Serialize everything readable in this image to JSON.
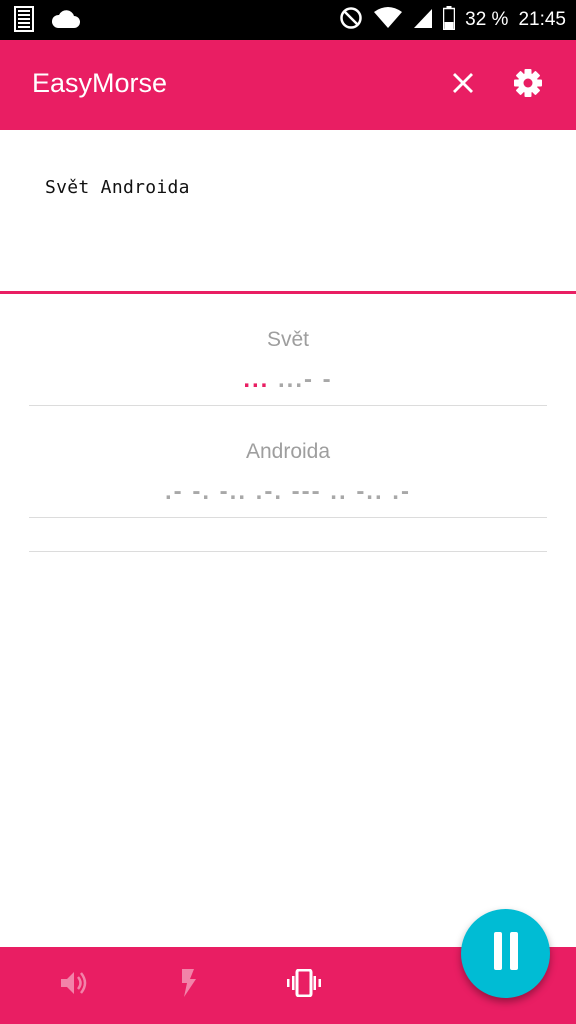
{
  "status_bar": {
    "battery_percent": "32 %",
    "time": "21:45",
    "icons": [
      "barcode-icon",
      "cloud-icon",
      "do-not-disturb-icon",
      "wifi-icon",
      "cell-signal-icon",
      "battery-icon"
    ]
  },
  "app_bar": {
    "title": "EasyMorse",
    "actions": [
      "close-icon",
      "settings-gear-icon"
    ]
  },
  "input": {
    "text": "Svět Androida"
  },
  "translation": {
    "words": [
      {
        "word": "Svět",
        "morse_played": "...",
        "morse_rest": " ...- -"
      },
      {
        "word": "Androida",
        "morse_played": "",
        "morse_rest": ".- -. -.. .-. --- .. -.. .-"
      }
    ]
  },
  "bottom_bar": {
    "buttons": [
      "sound-icon",
      "flash-icon",
      "vibrate-icon"
    ],
    "active": "vibrate-icon"
  },
  "fab": {
    "icon": "pause-icon"
  },
  "colors": {
    "primary": "#e91e63",
    "accent": "#00bcd4"
  }
}
